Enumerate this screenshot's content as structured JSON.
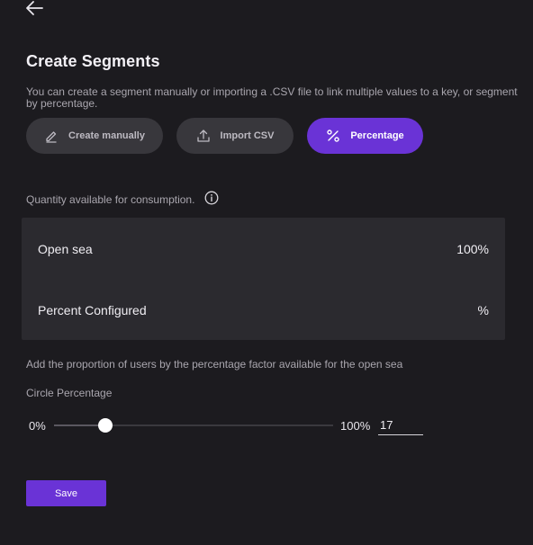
{
  "header": {
    "back_icon": "arrow-left-icon",
    "title": "Create Segments",
    "description": "You can create a segment manually or importing a .CSV file to link multiple values to a key, or segment by percentage."
  },
  "modes": [
    {
      "label": "Create manually",
      "icon": "pencil-icon",
      "active": false
    },
    {
      "label": "Import CSV",
      "icon": "upload-icon",
      "active": false
    },
    {
      "label": "Percentage",
      "icon": "percent-icon",
      "active": true
    }
  ],
  "quantity": {
    "label": "Quantity available for consumption.",
    "info_icon": "info-icon"
  },
  "summary": {
    "open_sea_label": "Open sea",
    "open_sea_value": "100%",
    "configured_label": "Percent Configured",
    "configured_value": "%"
  },
  "proportion_label": "Add the proportion of users by the percentage factor available for the open sea",
  "circle": {
    "label": "Circle Percentage",
    "min_label": "0%",
    "max_label": "100%",
    "value": "17",
    "slider_fraction": 0.185
  },
  "save_label": "Save",
  "colors": {
    "background": "#1c1b1f",
    "accent": "#6a33d6",
    "button_bg": "#38373c",
    "panel_bg": "#2b2a2f"
  }
}
